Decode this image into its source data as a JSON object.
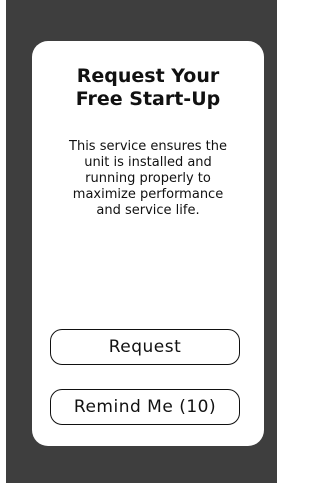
{
  "dialog": {
    "title_lines": [
      "Request Your",
      "Free Start-Up"
    ],
    "description_lines": [
      "This service ensures the",
      "unit is installed and",
      "running properly to",
      "maximize performance",
      "and service life."
    ],
    "primary_button_label": "Request",
    "secondary_button_label": "Remind Me (10)"
  },
  "colors": {
    "background": "#3e3e3e",
    "card": "#ffffff",
    "text": "#111111"
  }
}
